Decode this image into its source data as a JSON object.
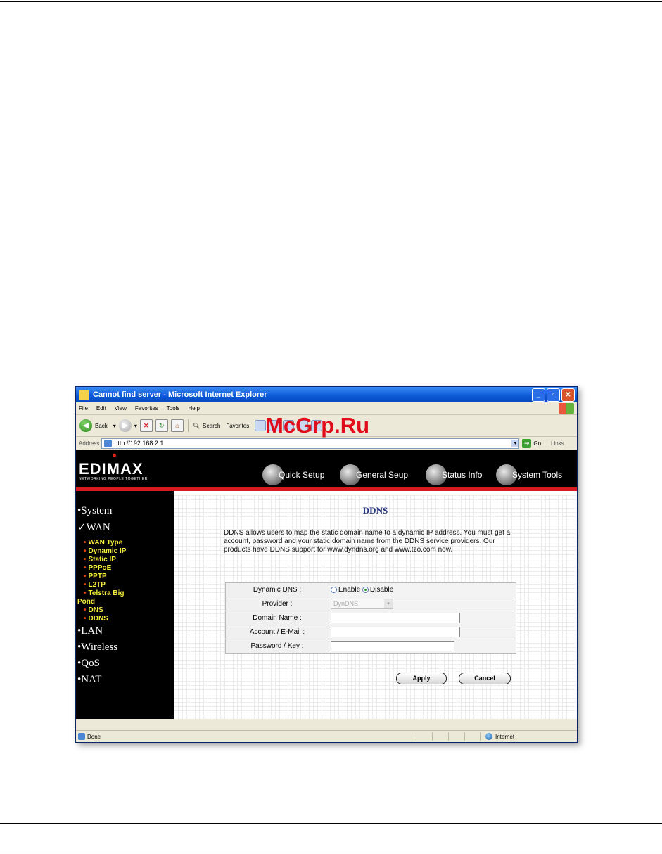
{
  "window": {
    "title": "Cannot find server - Microsoft Internet Explorer",
    "controls": [
      "minimize",
      "maximize",
      "close"
    ]
  },
  "menubar": [
    "File",
    "Edit",
    "View",
    "Favorites",
    "Tools",
    "Help"
  ],
  "toolbar": {
    "back_label": "Back",
    "search_label": "Search",
    "favorites_label": "Favorites"
  },
  "address": {
    "label": "Address",
    "url": "http://192.168.2.1",
    "go_label": "Go",
    "links_label": "Links"
  },
  "brand": {
    "logo": "EDIMAX",
    "tagline": "NETWORKING PEOPLE TOGETHER"
  },
  "topnav": [
    "Quick Setup",
    "General Seup",
    "Status Info",
    "System Tools"
  ],
  "sidebar": {
    "system": "System",
    "wan": "WAN",
    "wan_items": [
      "WAN Type",
      "Dynamic IP",
      "Static IP",
      "PPPoE",
      "PPTP",
      "L2TP",
      "Telstra Big",
      "Pond",
      "DNS",
      "DDNS"
    ],
    "lan": "LAN",
    "wireless": "Wireless",
    "qos": "QoS",
    "nat": "NAT"
  },
  "page": {
    "title": "DDNS",
    "description": "DDNS allows users to map the static domain name to a dynamic IP address. You must get a account, password and your static domain name from the DDNS service providers. Our products have DDNS support for www.dyndns.org and www.tzo.com now.",
    "fields": {
      "dynamic_dns_label": "Dynamic DNS :",
      "enable_label": "Enable",
      "disable_label": "Disable",
      "selected": "Disable",
      "provider_label": "Provider :",
      "provider_value": "DynDNS",
      "domain_name_label": "Domain Name :",
      "domain_name_value": "",
      "account_label": "Account / E-Mail :",
      "account_value": "",
      "password_label": "Password / Key :",
      "password_value": ""
    },
    "apply_label": "Apply",
    "cancel_label": "Cancel"
  },
  "status": {
    "text": "Done",
    "zone": "Internet"
  },
  "watermark": "McGrp.Ru",
  "colors": {
    "titlebar": "#0a58d6",
    "accent_red": "#d71920",
    "page_title": "#1f2f7a",
    "submenu": "#f5ee3b",
    "watermark": "#e10d1a"
  }
}
